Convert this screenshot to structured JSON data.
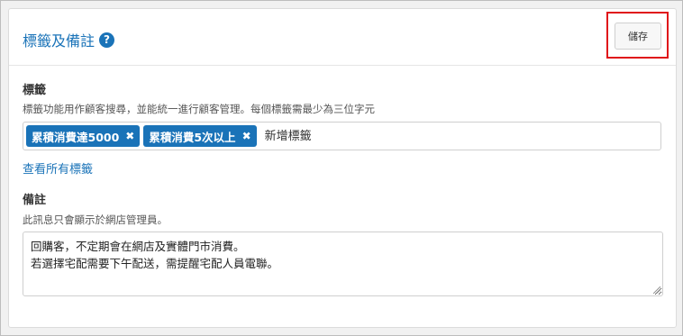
{
  "header": {
    "title": "標籤及備註",
    "help_icon": "?",
    "save_label": "儲存"
  },
  "tags": {
    "label": "標籤",
    "hint": "標籤功能用作顧客搜尋，並能統一進行顧客管理。每個標籤需最少為三位字元",
    "items": [
      {
        "text": "累積消費達5000",
        "remove": "✖"
      },
      {
        "text": "累積消費5次以上",
        "remove": "✖"
      }
    ],
    "input_placeholder": "新增標籤",
    "view_all_link": "查看所有標籤"
  },
  "notes": {
    "label": "備註",
    "hint": "此訊息只會顯示於網店管理員。",
    "lines": [
      "回購客，不定期會在網店及實體門市消費。",
      "若選擇宅配需要下午配送，需提醒宅配人員電聯。"
    ]
  },
  "colors": {
    "accent": "#1a73b8",
    "highlight": "#e0141a"
  }
}
